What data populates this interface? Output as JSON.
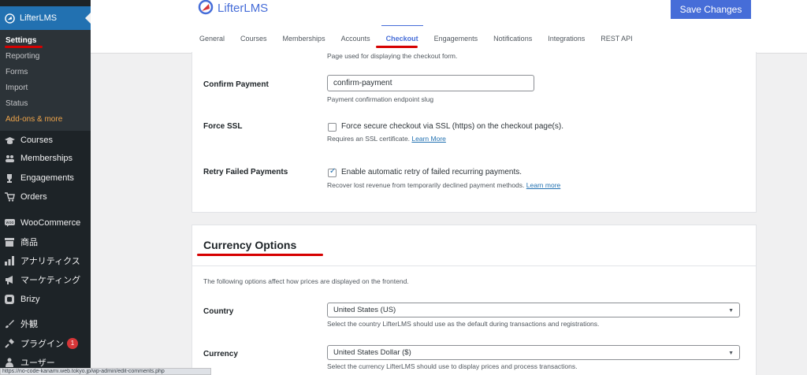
{
  "sidebar": {
    "top_item": "LifterLMS",
    "submenu": [
      "Settings",
      "Reporting",
      "Forms",
      "Import",
      "Status",
      "Add-ons & more"
    ],
    "menu": [
      {
        "label": "Courses",
        "icon": "graduation-cap-icon"
      },
      {
        "label": "Memberships",
        "icon": "group-icon"
      },
      {
        "label": "Engagements",
        "icon": "trophy-icon"
      },
      {
        "label": "Orders",
        "icon": "cart-icon"
      },
      {
        "label": "WooCommerce",
        "icon": "woocommerce-icon"
      },
      {
        "label": "商品",
        "icon": "archive-icon"
      },
      {
        "label": "アナリティクス",
        "icon": "bar-chart-icon"
      },
      {
        "label": "マーケティング",
        "icon": "megaphone-icon"
      },
      {
        "label": "Brizy",
        "icon": "brizy-icon"
      },
      {
        "label": "外観",
        "icon": "paint-brush-icon"
      },
      {
        "label": "プラグイン",
        "icon": "plug-icon",
        "badge": "1"
      },
      {
        "label": "ユーザー",
        "icon": "user-icon"
      }
    ]
  },
  "header": {
    "logo": "LifterLMS",
    "save_button": "Save Changes",
    "tabs": [
      "General",
      "Courses",
      "Memberships",
      "Accounts",
      "Checkout",
      "Engagements",
      "Notifications",
      "Integrations",
      "REST API"
    ],
    "active_tab": "Checkout"
  },
  "checkout": {
    "top_desc": "Page used for displaying the checkout form.",
    "confirm_label": "Confirm Payment",
    "confirm_value": "confirm-payment",
    "confirm_desc": "Payment confirmation endpoint slug",
    "ssl_label": "Force SSL",
    "ssl_checkbox": "Force secure checkout via SSL (https) on the checkout page(s).",
    "ssl_desc": "Requires an SSL certificate.",
    "ssl_link": "Learn More",
    "retry_label": "Retry Failed Payments",
    "retry_checkbox": "Enable automatic retry of failed recurring payments.",
    "retry_desc": "Recover lost revenue from temporarily declined payment methods.",
    "retry_link": "Learn more"
  },
  "currency": {
    "title": "Currency Options",
    "intro": "The following options affect how prices are displayed on the frontend.",
    "country_label": "Country",
    "country_value": "United States (US)",
    "country_desc": "Select the country LifterLMS should use as the default during transactions and registrations.",
    "currency_label": "Currency",
    "currency_value": "United States Dollar ($)",
    "currency_desc": "Select the currency LifterLMS should use to display prices and process transactions."
  },
  "status_url": "https://no-code-kanami.web.tokyo.jp/wp-admin/edit-comments.php"
}
